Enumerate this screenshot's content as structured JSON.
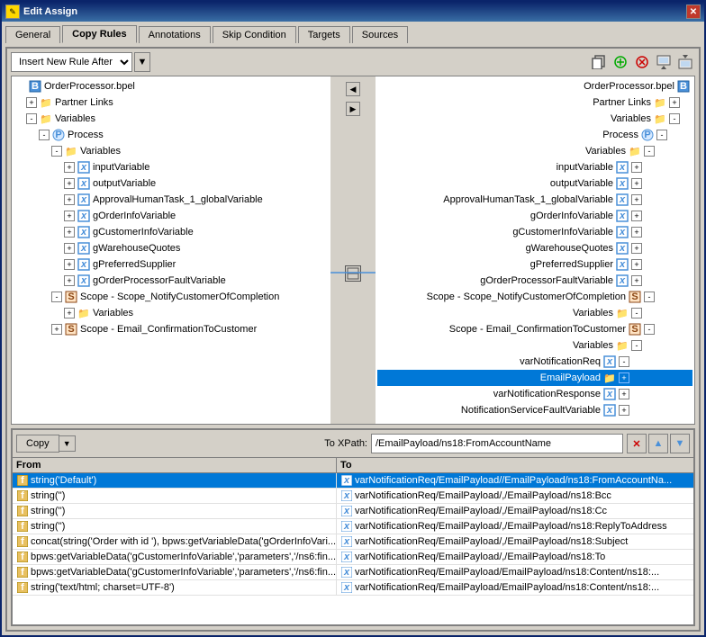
{
  "window": {
    "title": "Edit Assign",
    "icon": "✎"
  },
  "tabs": [
    {
      "label": "General",
      "active": false
    },
    {
      "label": "Copy Rules",
      "active": true
    },
    {
      "label": "Annotations",
      "active": false
    },
    {
      "label": "Skip Condition",
      "active": false
    },
    {
      "label": "Targets",
      "active": false
    },
    {
      "label": "Sources",
      "active": false
    }
  ],
  "toolbar": {
    "insert_label": "Insert New Rule After",
    "icons": [
      "📋",
      "➕",
      "✕",
      "📄",
      "📄"
    ]
  },
  "left_tree": {
    "root": "OrderProcessor.bpel",
    "items": [
      {
        "label": "Partner Links",
        "indent": 1,
        "type": "folder",
        "expand": "+"
      },
      {
        "label": "Variables",
        "indent": 1,
        "type": "folder",
        "expand": "-"
      },
      {
        "label": "Process",
        "indent": 2,
        "type": "process",
        "expand": "-"
      },
      {
        "label": "Variables",
        "indent": 3,
        "type": "folder",
        "expand": "-"
      },
      {
        "label": "inputVariable",
        "indent": 4,
        "type": "var"
      },
      {
        "label": "outputVariable",
        "indent": 4,
        "type": "var"
      },
      {
        "label": "ApprovalHumanTask_1_globalVariable",
        "indent": 4,
        "type": "var"
      },
      {
        "label": "gOrderInfoVariable",
        "indent": 4,
        "type": "var"
      },
      {
        "label": "gCustomerInfoVariable",
        "indent": 4,
        "type": "var"
      },
      {
        "label": "gWarehouseQuotes",
        "indent": 4,
        "type": "var"
      },
      {
        "label": "gPreferredSupplier",
        "indent": 4,
        "type": "var"
      },
      {
        "label": "gOrderProcessorFaultVariable",
        "indent": 4,
        "type": "var"
      },
      {
        "label": "Scope - Scope_NotifyCustomerOfCompletion",
        "indent": 3,
        "type": "scope",
        "expand": "-"
      },
      {
        "label": "Variables",
        "indent": 4,
        "type": "folder",
        "expand": "+"
      },
      {
        "label": "Scope - Email_ConfirmationToCustomer",
        "indent": 3,
        "type": "scope",
        "expand": "+"
      }
    ]
  },
  "right_tree": {
    "root": "OrderProcessor.bpel",
    "items": [
      {
        "label": "Partner Links",
        "indent": 1,
        "type": "folder"
      },
      {
        "label": "Variables",
        "indent": 1,
        "type": "folder",
        "expand": "-"
      },
      {
        "label": "Process",
        "indent": 2,
        "type": "process"
      },
      {
        "label": "Variables",
        "indent": 3,
        "type": "folder",
        "expand": "-"
      },
      {
        "label": "inputVariable",
        "indent": 4,
        "type": "var"
      },
      {
        "label": "outputVariable",
        "indent": 4,
        "type": "var"
      },
      {
        "label": "ApprovalHumanTask_1_globalVariable",
        "indent": 4,
        "type": "var"
      },
      {
        "label": "gOrderInfoVariable",
        "indent": 4,
        "type": "var"
      },
      {
        "label": "gCustomerInfoVariable",
        "indent": 4,
        "type": "var"
      },
      {
        "label": "gWarehouseQuotes",
        "indent": 4,
        "type": "var"
      },
      {
        "label": "gPreferredSupplier",
        "indent": 4,
        "type": "var"
      },
      {
        "label": "gOrderProcessorFaultVariable",
        "indent": 4,
        "type": "var"
      },
      {
        "label": "Scope - Scope_NotifyCustomerOfCompletion",
        "indent": 3,
        "type": "scope",
        "expand": "-"
      },
      {
        "label": "Variables",
        "indent": 4,
        "type": "folder",
        "expand": "-"
      },
      {
        "label": "Scope - Email_ConfirmationToCustomer",
        "indent": 3,
        "type": "scope",
        "expand": "-"
      },
      {
        "label": "Variables",
        "indent": 4,
        "type": "folder",
        "expand": "-"
      },
      {
        "label": "varNotificationReq",
        "indent": 5,
        "type": "var"
      },
      {
        "label": "EmailPayload",
        "indent": 5,
        "type": "folder",
        "selected": true
      },
      {
        "label": "varNotificationResponse",
        "indent": 5,
        "type": "var"
      },
      {
        "label": "NotificationServiceFaultVariable",
        "indent": 5,
        "type": "var"
      }
    ]
  },
  "bottom_panel": {
    "copy_label": "Copy",
    "to_xpath_label": "To XPath:",
    "xpath_value": "/EmailPayload/ns18:FromAccountName",
    "table": {
      "col_from": "From",
      "col_to": "To",
      "rows": [
        {
          "from": "string('Default')",
          "to": "varNotificationReq/EmailPayload//EmailPayload/ns18:FromAccountNa...",
          "selected": true
        },
        {
          "from": "string('')",
          "to": "varNotificationReq/EmailPayload/,/EmailPayload/ns18:Bcc",
          "selected": false
        },
        {
          "from": "string('')",
          "to": "varNotificationReq/EmailPayload/,/EmailPayload/ns18:Cc",
          "selected": false
        },
        {
          "from": "string('')",
          "to": "varNotificationReq/EmailPayload/,/EmailPayload/ns18:ReplyToAddress",
          "selected": false
        },
        {
          "from": "concat(string('Order with id '), bpws:getVariableData('gOrderInfoVari...",
          "to": "varNotificationReq/EmailPayload/,/EmailPayload/ns18:Subject",
          "selected": false
        },
        {
          "from": "bpws:getVariableData('gCustomerInfoVariable','parameters','/ns6:fin...",
          "to": "varNotificationReq/EmailPayload/,/EmailPayload/ns18:To",
          "selected": false
        },
        {
          "from": "bpws:getVariableData('gCustomerInfoVariable','parameters','/ns6:fin...",
          "to": "varNotificationReq/EmailPayload/EmailPayload/ns18:Content/ns18:...",
          "selected": false
        },
        {
          "from": "string('text/html; charset=UTF-8')",
          "to": "varNotificationReq/EmailPayload/EmailPayload/ns18:Content/ns18:...",
          "selected": false
        }
      ]
    }
  }
}
